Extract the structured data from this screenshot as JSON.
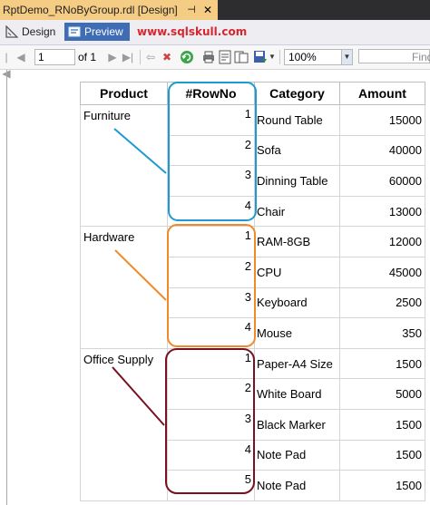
{
  "window": {
    "doc_tab_title": "RptDemo_RNoByGroup.rdl [Design]",
    "pin_glyph": "⊣",
    "close_glyph": "✕",
    "tab_color": "#f5cc84"
  },
  "modes": {
    "design_label": "Design",
    "preview_label": "Preview",
    "active": "Preview",
    "active_color": "#3e6db5"
  },
  "watermark": "www.sqlskull.com",
  "toolbar": {
    "page_value": "1",
    "of_label": "of 1",
    "zoom_value": "100%",
    "find_placeholder": "Find"
  },
  "report": {
    "headers": [
      "Product",
      "#RowNo",
      "Category",
      "Amount"
    ],
    "groups": [
      {
        "name": "Furniture",
        "box_color": "#1b9bd1",
        "rows": [
          {
            "rowno": "1",
            "category": "Round Table",
            "amount": "15000"
          },
          {
            "rowno": "2",
            "category": "Sofa",
            "amount": "40000"
          },
          {
            "rowno": "3",
            "category": "Dinning Table",
            "amount": "60000"
          },
          {
            "rowno": "4",
            "category": "Chair",
            "amount": "13000"
          }
        ]
      },
      {
        "name": "Hardware",
        "box_color": "#ef8a2a",
        "rows": [
          {
            "rowno": "1",
            "category": "RAM-8GB",
            "amount": "12000"
          },
          {
            "rowno": "2",
            "category": "CPU",
            "amount": "45000"
          },
          {
            "rowno": "3",
            "category": "Keyboard",
            "amount": "2500"
          },
          {
            "rowno": "4",
            "category": "Mouse",
            "amount": "350"
          }
        ]
      },
      {
        "name": "Office Supply",
        "box_color": "#7a1022",
        "rows": [
          {
            "rowno": "1",
            "category": "Paper-A4 Size",
            "amount": "1500"
          },
          {
            "rowno": "2",
            "category": "White Board",
            "amount": "5000"
          },
          {
            "rowno": "3",
            "category": "Black Marker",
            "amount": "1500"
          },
          {
            "rowno": "4",
            "category": "Note Pad",
            "amount": "1500"
          },
          {
            "rowno": "5",
            "category": "Note Pad",
            "amount": "1500"
          }
        ]
      }
    ]
  }
}
